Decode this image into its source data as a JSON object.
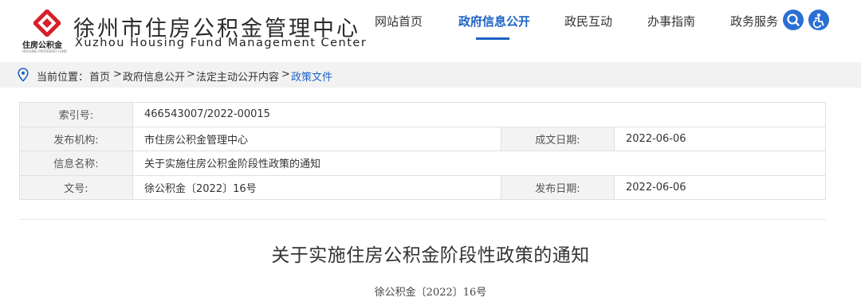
{
  "site": {
    "title": "徐州市住房公积金管理中心",
    "subtitle_cn": "住房公积金",
    "subtitle_en": "Xuzhou Housing Fund Management Center",
    "subtitle_tiny": "HOUSING PROVIDENT FUND"
  },
  "nav": {
    "items": [
      {
        "label": "网站首页"
      },
      {
        "label": "政府信息公开",
        "active": true
      },
      {
        "label": "政民互动"
      },
      {
        "label": "办事指南"
      },
      {
        "label": "政务服务"
      }
    ]
  },
  "breadcrumb": {
    "prefix": "当前位置：",
    "items": [
      "首页",
      "政府信息公开",
      "法定主动公开内容"
    ],
    "separator": ">",
    "current": "政策文件"
  },
  "info": {
    "index_label": "索引号:",
    "index_value": "466543007/2022-00015",
    "publisher_label": "发布机构:",
    "publisher_value": "市住房公积金管理中心",
    "created_label": "成文日期:",
    "created_value": "2022-06-06",
    "name_label": "信息名称:",
    "name_value": "关于实施住房公积金阶段性政策的通知",
    "doc_no_label": "文号:",
    "doc_no_value": "徐公积金〔2022〕16号",
    "published_label": "发布日期:",
    "published_value": "2022-06-06"
  },
  "document": {
    "title": "关于实施住房公积金阶段性政策的通知",
    "number": "徐公积金〔2022〕16号"
  },
  "colors": {
    "accent": "#1e63c4",
    "logo_red": "#d6202a",
    "crumb_bg": "#f2f2f2",
    "label_bg": "#f3f3f3"
  },
  "icons": [
    "logo-emblem-icon",
    "search-icon",
    "accessibility-icon",
    "location-pin-icon"
  ]
}
